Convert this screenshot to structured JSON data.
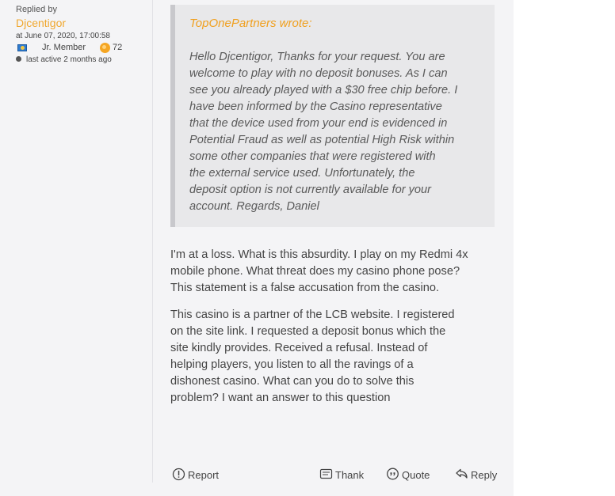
{
  "author": {
    "replied_by_label": "Replied by",
    "username": "Djcentigor",
    "date": "at June 07, 2020, 17:00:58",
    "rank": "Jr. Member",
    "reputation": "72",
    "status": "last active 2 months ago",
    "flag_icon": "flag-icon",
    "reputation_icon": "reputation-icon"
  },
  "quote": {
    "author": "TopOnePartners wrote:",
    "lines": [
      "Hello Djcentigor, Thanks for your request. You are",
      "welcome to play with no deposit bonuses. As I can",
      "see you already played with a $30 free chip before. I",
      "have been informed by the Casino representative",
      "that the device used from your end is evidenced in",
      "Potential Fraud as well as potential High Risk within",
      "some other companies that were registered with",
      "the external service used. Unfortunately, the",
      "deposit option is not currently available for your",
      "account. Regards, Daniel"
    ]
  },
  "body": {
    "p1_lines": [
      "I'm at a loss. What is this absurdity. I play on my Redmi 4x",
      "mobile phone. What threat does my casino phone pose?",
      "This statement is a false accusation from the casino."
    ],
    "p2_lines": [
      "This casino is a partner of the LCB website. I registered",
      "on the site link. I requested a deposit bonus which the",
      "site kindly provides. Received a refusal. Instead of",
      "helping players, you listen to all the ravings of a",
      "dishonest casino. What can you do to solve this",
      "problem? I want an answer to this question"
    ]
  },
  "actions": {
    "report": "Report",
    "thank": "Thank",
    "quote": "Quote",
    "reply": "Reply"
  },
  "colors": {
    "username": "#f0a830",
    "quote_author": "#f0a020",
    "background": "#f4f4f6"
  }
}
